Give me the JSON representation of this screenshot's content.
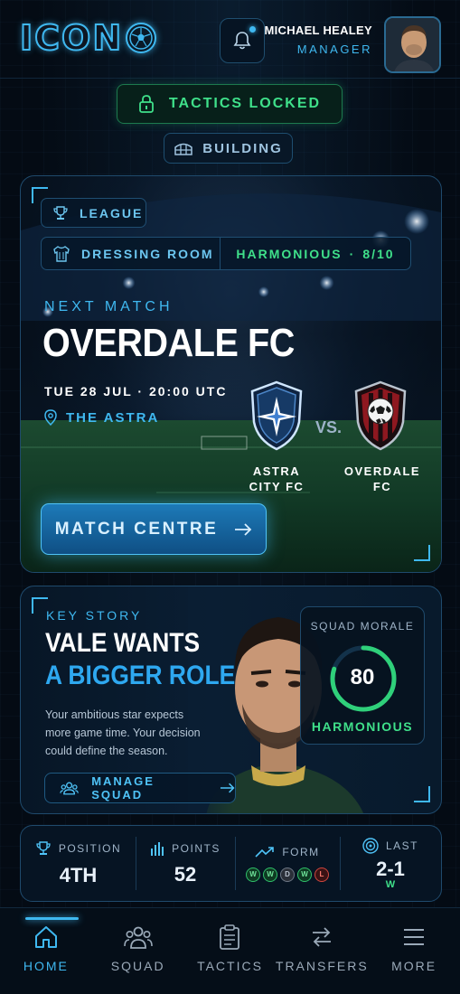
{
  "app": {
    "logo_text": "ICON"
  },
  "header": {
    "user_name": "MICHAEL HEALEY",
    "user_role": "MANAGER"
  },
  "status": {
    "tactics_label": "TACTICS LOCKED",
    "building_label": "BUILDING"
  },
  "match": {
    "competition": "LEAGUE",
    "dressing_room_label": "DRESSING ROOM",
    "dressing_room_status": "HARMONIOUS",
    "dressing_room_score": "8/10",
    "next_match_label": "NEXT MATCH",
    "opponent": "OVERDALE FC",
    "datetime": "TUE 28 JUL · 20:00 UTC",
    "venue": "THE ASTRA",
    "home_team": "ASTRA\nCITY FC",
    "away_team": "OVERDALE\nFC",
    "vs_label": "VS.",
    "button_label": "MATCH CENTRE"
  },
  "story": {
    "label": "KEY STORY",
    "headline_line1": "VALE WANTS",
    "headline_line2": "A BIGGER ROLE",
    "body": "Your ambitious star expects more game time. Your decision could define the season.",
    "button_label": "MANAGE SQUAD"
  },
  "morale": {
    "label": "SQUAD MORALE",
    "value": "80",
    "fraction": 0.8,
    "status": "HARMONIOUS"
  },
  "stats": {
    "position_label": "POSITION",
    "position_value": "4TH",
    "points_label": "POINTS",
    "points_value": "52",
    "form_label": "FORM",
    "form": [
      "W",
      "W",
      "D",
      "W",
      "L"
    ],
    "last_label": "LAST",
    "last_score": "2-1",
    "last_result": "W"
  },
  "nav": {
    "items": [
      {
        "label": "HOME",
        "icon": "home-icon",
        "active": true
      },
      {
        "label": "SQUAD",
        "icon": "squad-icon",
        "active": false
      },
      {
        "label": "TACTICS",
        "icon": "clipboard-icon",
        "active": false
      },
      {
        "label": "TRANSFERS",
        "icon": "transfer-arrows-icon",
        "active": false
      },
      {
        "label": "MORE",
        "icon": "menu-icon",
        "active": false
      }
    ]
  },
  "colors": {
    "accent": "#3fb8f0",
    "success": "#3fe08a",
    "danger": "#d0463e",
    "background": "#040b14"
  }
}
